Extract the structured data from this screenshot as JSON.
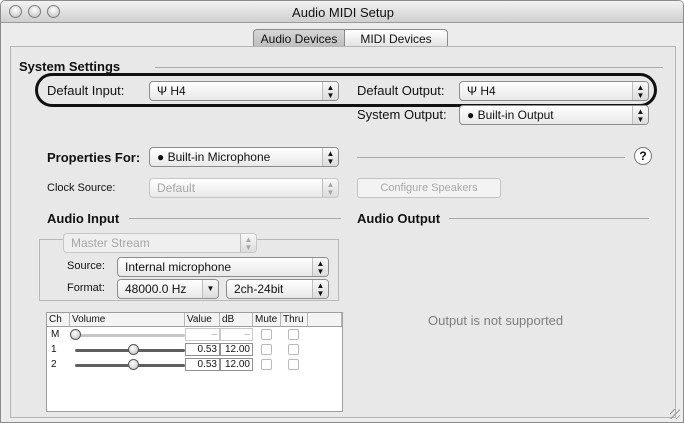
{
  "window": {
    "title": "Audio MIDI Setup"
  },
  "tabs": [
    "Audio Devices",
    "MIDI Devices"
  ],
  "system_settings": {
    "heading": "System Settings",
    "default_input_label": "Default Input:",
    "default_input_value": "H4",
    "default_output_label": "Default Output:",
    "default_output_value": "H4",
    "system_output_label": "System Output:",
    "system_output_value": "Built-in Output"
  },
  "properties": {
    "label": "Properties For:",
    "value": "Built-in Microphone",
    "clock_source_label": "Clock Source:",
    "clock_source_value": "Default",
    "configure_speakers": "Configure Speakers",
    "help": "?"
  },
  "audio_input": {
    "heading": "Audio Input",
    "stream": "Master Stream",
    "source_label": "Source:",
    "source_value": "Internal microphone",
    "format_label": "Format:",
    "format_rate": "48000.0 Hz",
    "format_bits": "2ch-24bit",
    "table": {
      "headers": [
        "Ch",
        "Volume",
        "Value",
        "dB",
        "Mute",
        "Thru"
      ],
      "rows": [
        {
          "ch": "M",
          "value": "–",
          "db": "–",
          "level": 0.0
        },
        {
          "ch": "1",
          "value": "0.53",
          "db": "12.00",
          "level": 0.53
        },
        {
          "ch": "2",
          "value": "0.53",
          "db": "12.00",
          "level": 0.53
        }
      ]
    }
  },
  "audio_output": {
    "heading": "Audio Output",
    "message": "Output is not supported"
  },
  "icons": {
    "usb": "Ψ",
    "apple": "●",
    "stepper": "▲▼",
    "dropdown": "▼"
  }
}
